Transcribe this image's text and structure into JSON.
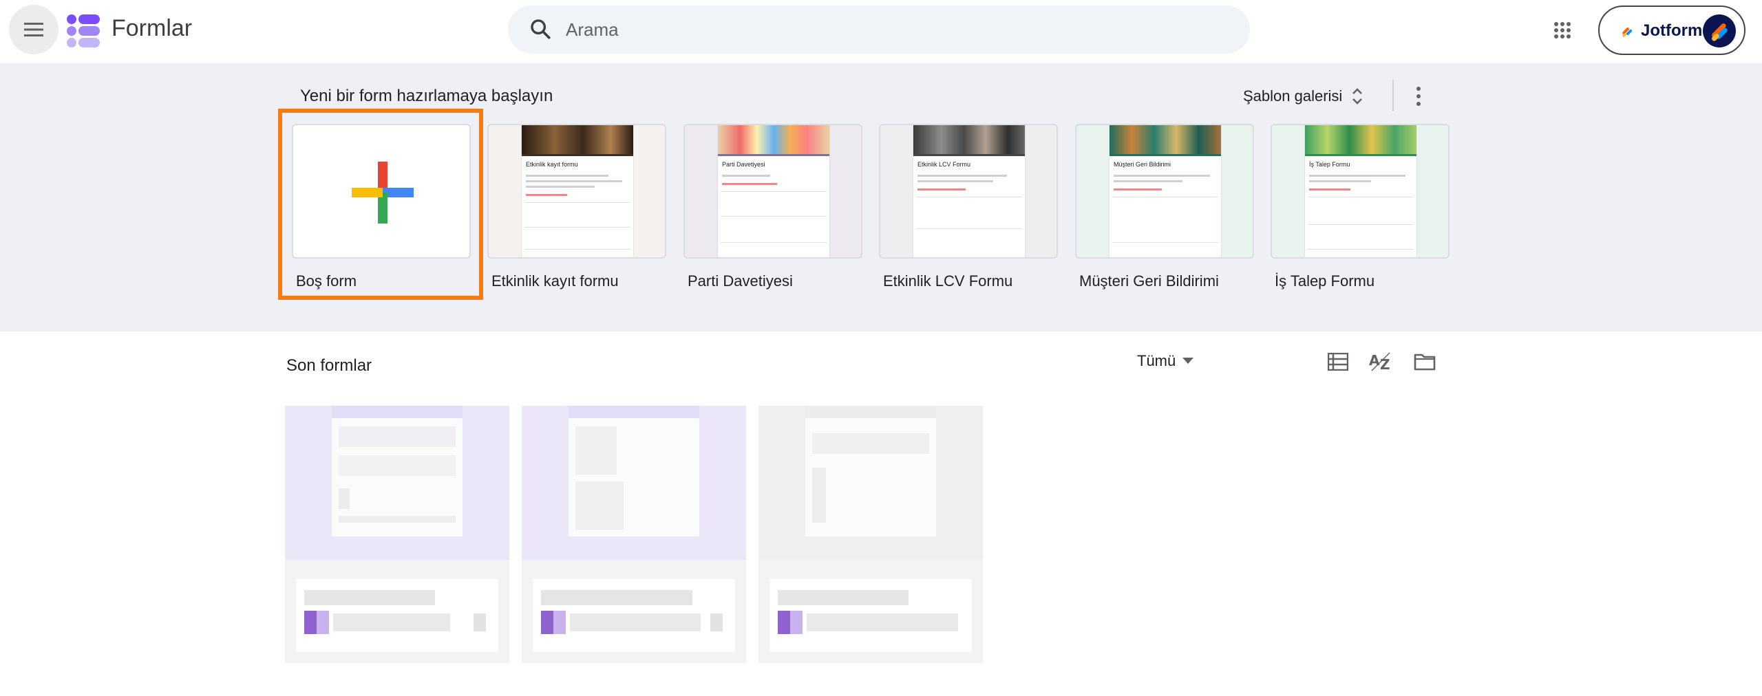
{
  "header": {
    "app_title": "Formlar",
    "search_placeholder": "Arama",
    "account_brand": "Jotform"
  },
  "templates": {
    "section_title": "Yeni bir form hazırlamaya başlayın",
    "gallery_label": "Şablon galerisi",
    "items": [
      {
        "label": "Boş form",
        "doc_title": ""
      },
      {
        "label": "Etkinlik kayıt formu",
        "doc_title": "Etkinlik kayıt formu"
      },
      {
        "label": "Parti Davetiyesi",
        "doc_title": "Parti Davetiyesi"
      },
      {
        "label": "Etkinlik LCV Formu",
        "doc_title": "Etkinlik LCV Formu"
      },
      {
        "label": "Müşteri Geri Bildirimi",
        "doc_title": "Müşteri Geri Bildirimi"
      },
      {
        "label": "İş Talep Formu",
        "doc_title": "İş Talep Formu"
      }
    ]
  },
  "recent": {
    "section_title": "Son formlar",
    "filter_label": "Tümü"
  },
  "colors": {
    "highlight": "#f57c12",
    "band_bg": "#eef0f6",
    "form_purple": "#7248b9"
  }
}
